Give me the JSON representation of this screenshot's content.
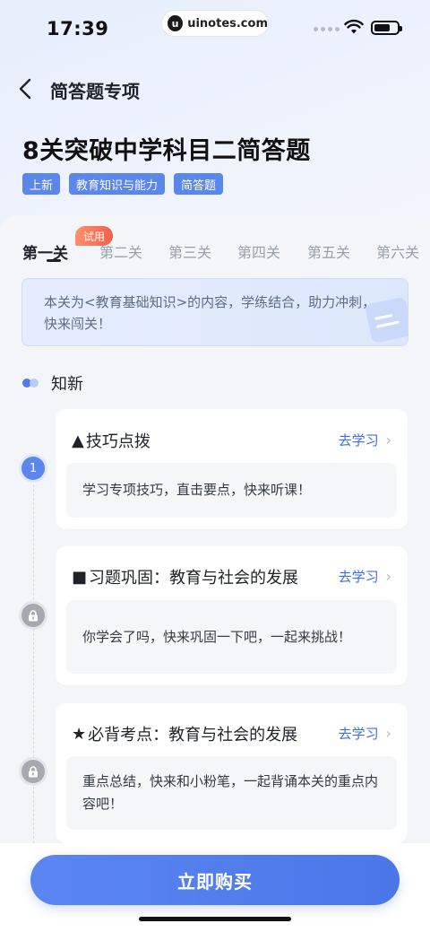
{
  "status_bar": {
    "time": "17:39",
    "watermark": "uinotes.com",
    "watermark_logo": "u"
  },
  "nav": {
    "title": "简答题专项"
  },
  "course": {
    "title": "8关突破中学科目二简答题",
    "tags": [
      "上新",
      "教育知识与能力",
      "简答题"
    ]
  },
  "tabs": {
    "items": [
      "第一关",
      "第二关",
      "第三关",
      "第四关",
      "第五关",
      "第六关"
    ],
    "active_index": 0,
    "badge": "试用"
  },
  "notice": {
    "text": "本关为<教育基础知识>的内容，学练结合，助力冲刺，快来闯关！"
  },
  "section": {
    "title": "知新"
  },
  "cards": [
    {
      "node": "1",
      "prefix": "▲",
      "title": "技巧点拨",
      "link": "去学习",
      "desc": "学习专项技巧，直击要点，快来听课！",
      "locked": false
    },
    {
      "node": "",
      "prefix": "■",
      "title": "习题巩固：教育与社会的发展",
      "link": "去学习",
      "desc": "你学会了吗，快来巩固一下吧，一起来挑战！",
      "locked": true
    },
    {
      "node": "",
      "prefix": "★",
      "title": "必背考点：教育与社会的发展",
      "link": "去学习",
      "desc": "重点总结，快来和小粉笔，一起背诵本关的重点内容吧！",
      "locked": true
    }
  ],
  "bottom": {
    "buy_label": "立即购买"
  },
  "colors": {
    "accent": "#4a76e9",
    "tag_bg": "#5b86ea",
    "badge": "#f26049",
    "link": "#3b6fe0"
  }
}
